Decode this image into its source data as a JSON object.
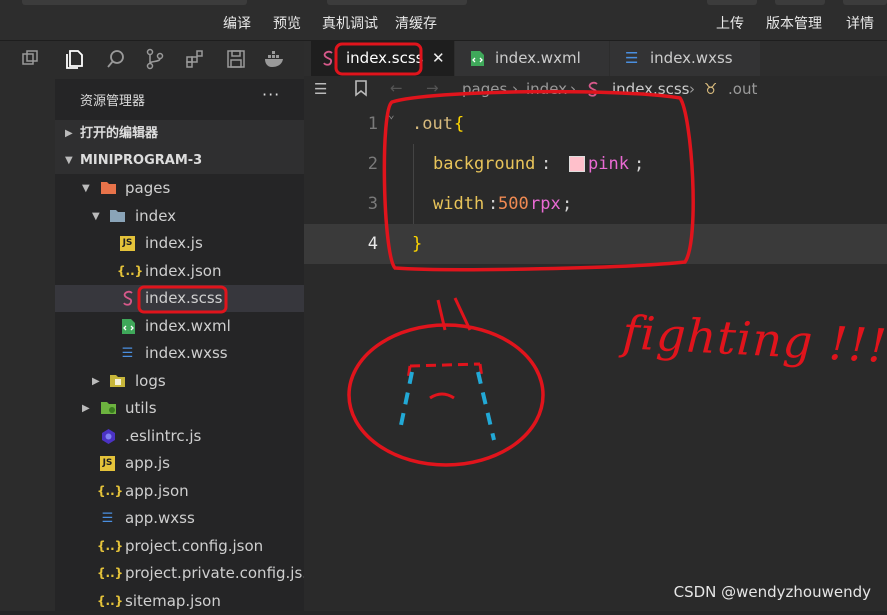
{
  "toolbar": {
    "items_left": [
      "编译",
      "预览",
      "真机调试",
      "清缓存"
    ],
    "items_right": [
      "上传",
      "版本管理",
      "详情"
    ]
  },
  "activity_icons": [
    "split-icon",
    "files-icon",
    "search-icon",
    "branch-icon",
    "extensions-icon",
    "save-icon",
    "docker-icon"
  ],
  "explorer": {
    "title": "资源管理器",
    "more": "···",
    "open_editors": "打开的编辑器",
    "project": "MINIPROGRAM-3",
    "tree": [
      {
        "label": "pages",
        "icon": "folder-icon",
        "arrow": "▼"
      },
      {
        "label": "index",
        "icon": "folder-icon",
        "arrow": "▼"
      },
      {
        "label": "index.js",
        "icon": "js-file-icon",
        "arrow": ""
      },
      {
        "label": "index.json",
        "icon": "json-file-icon",
        "arrow": ""
      },
      {
        "label": "index.scss",
        "icon": "scss-file-icon",
        "arrow": ""
      },
      {
        "label": "index.wxml",
        "icon": "wxml-file-icon",
        "arrow": ""
      },
      {
        "label": "index.wxss",
        "icon": "css-file-icon",
        "arrow": ""
      },
      {
        "label": "logs",
        "icon": "folder-icon",
        "arrow": "▶"
      },
      {
        "label": "utils",
        "icon": "folder-icon",
        "arrow": "▶"
      },
      {
        "label": ".eslintrc.js",
        "icon": "eslint-file-icon",
        "arrow": ""
      },
      {
        "label": "app.js",
        "icon": "js-file-icon",
        "arrow": ""
      },
      {
        "label": "app.json",
        "icon": "json-file-icon",
        "arrow": ""
      },
      {
        "label": "app.wxss",
        "icon": "css-file-icon",
        "arrow": ""
      },
      {
        "label": "project.config.json",
        "icon": "json-file-icon",
        "arrow": ""
      },
      {
        "label": "project.private.config.js...",
        "icon": "json-file-icon",
        "arrow": ""
      },
      {
        "label": "sitemap.json",
        "icon": "json-file-icon",
        "arrow": ""
      }
    ]
  },
  "tabs": [
    {
      "label": "index.scss",
      "close": "✕"
    },
    {
      "label": "index.wxml"
    },
    {
      "label": "index.wxss"
    }
  ],
  "breadcrumb": [
    "pages",
    "index",
    "index.scss",
    ".out"
  ],
  "code": {
    "line_numbers": [
      "1",
      "2",
      "3",
      "4"
    ],
    "line1_selector": ".out",
    "line1_brace": "{",
    "line2_prop": "background",
    "line2_colon": ":",
    "line2_value": "pink",
    "line2_semi": ";",
    "line3_prop": "width",
    "line3_colon": ":",
    "line3_num": "500",
    "line3_unit": "rpx",
    "line3_semi": ";",
    "line4_brace": "}"
  },
  "annotation": {
    "text": "fighting !!!"
  },
  "watermark": "CSDN @wendyzhouwendy",
  "colors": {
    "annotation": "#e0141c",
    "tear": "#22a9d6",
    "selector": "#d7ba7d",
    "property": "#e8c45a",
    "value": "#e96ad3",
    "number": "#f08a52"
  }
}
